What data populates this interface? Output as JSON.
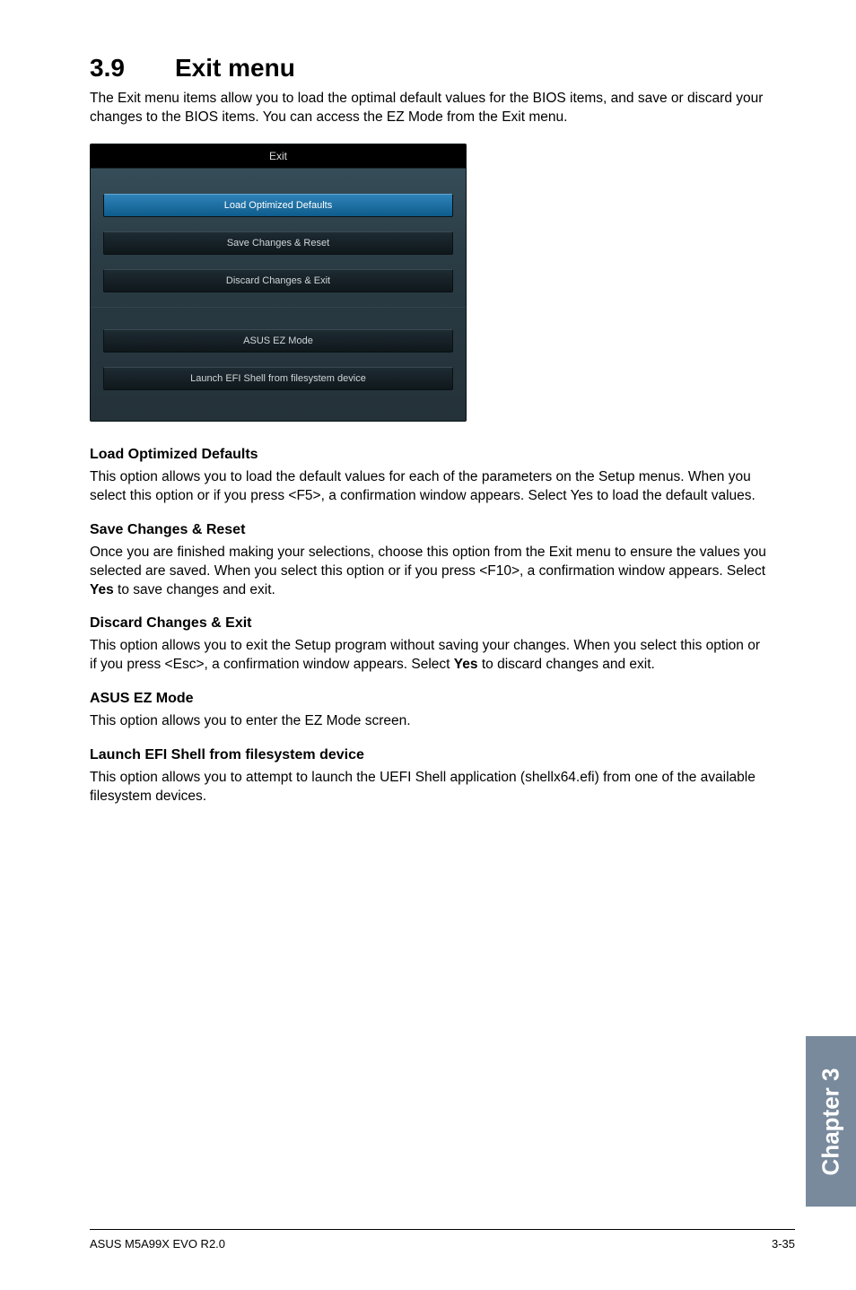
{
  "heading": {
    "num": "3.9",
    "title": "Exit menu"
  },
  "intro": "The Exit menu items allow you to load the optimal default values for the BIOS items, and save or discard your changes to the BIOS items. You can access the EZ Mode from the Exit menu.",
  "dialog": {
    "title": "Exit",
    "items": [
      "Load Optimized Defaults",
      "Save Changes & Reset",
      "Discard Changes & Exit",
      "ASUS EZ Mode",
      "Launch EFI Shell from filesystem device"
    ]
  },
  "sections": {
    "lod": {
      "title": "Load Optimized Defaults",
      "body": "This option allows you to load the default values for each of the parameters on the Setup menus. When you select this option or if you press <F5>, a confirmation window appears. Select Yes to load the default values."
    },
    "scr": {
      "title": "Save Changes & Reset",
      "pre": "Once you are finished making your selections, choose this option from the Exit menu to ensure the values you selected are saved. When you select this option or if you press <F10>, a confirmation window appears. Select ",
      "yes": "Yes",
      "post": " to save changes and exit."
    },
    "dce": {
      "title": "Discard Changes & Exit",
      "pre": "This option allows you to exit the Setup program without saving your changes. When you select this option or if you press <Esc>, a confirmation window appears. Select ",
      "yes": "Yes",
      "post": " to discard changes and exit."
    },
    "ez": {
      "title": "ASUS EZ Mode",
      "body": "This option allows you to enter the EZ Mode screen."
    },
    "efi": {
      "title": "Launch EFI Shell from filesystem device",
      "body": "This option allows you to attempt to launch the UEFI Shell application (shellx64.efi) from one of the available filesystem devices."
    }
  },
  "sideTab": "Chapter 3",
  "footer": {
    "left": "ASUS M5A99X EVO R2.0",
    "right": "3-35"
  }
}
